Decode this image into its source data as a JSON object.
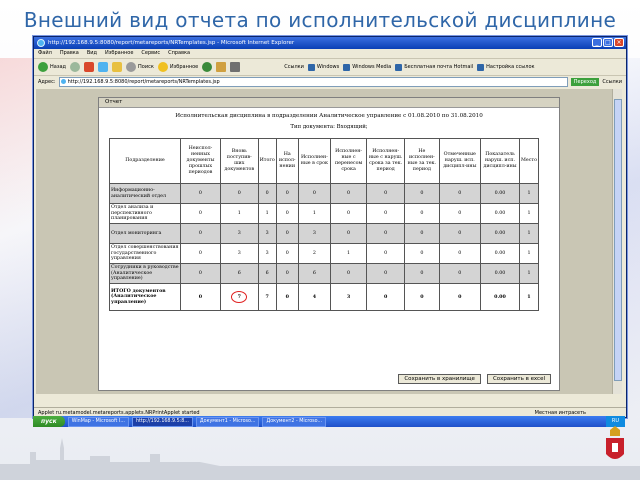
{
  "slide": {
    "title": "Внешний вид отчета по исполнительской дисциплине"
  },
  "window": {
    "title": "http://192.168.9.5:8080/report/metareports/NRTemplates.jsp - Microsoft Internet Explorer",
    "menu": [
      "Файл",
      "Правка",
      "Вид",
      "Избранное",
      "Сервис",
      "Справка"
    ],
    "toolbar": [
      "Назад",
      "Вперед",
      "Остановить",
      "Обновить",
      "Домой",
      "Поиск",
      "Избранное",
      "Журнал",
      "Почта",
      "Печать",
      "Ссылки",
      "Windows",
      "Windows Media",
      "Бесплатная почта Hotmail",
      "Настройка ссылок"
    ],
    "address_label": "Адрес:",
    "address": "http://192.168.9.5:8080/report/metareports/NRTemplates.jsp",
    "go_label": "Переход",
    "links_label": "Ссылки"
  },
  "report": {
    "caption": "Отчет",
    "title": "Исполнительская дисциплина в подразделении Аналитическое управление с 01.08.2010 по 31.08.2010",
    "doctype": "Тип документа: Входящий;",
    "columns": [
      "Подразделение",
      "Неиспол-ненных документы прошлых периодов",
      "Вновь поступив-ших документов",
      "Итого",
      "На испол-нении",
      "Исполнен-ные в срок",
      "Исполнен-ные с перенесом срока",
      "Исполнен-ные с наруш. срока за тек. период",
      "Не исполнен-ные за тек. период",
      "Отмеченные наруш. исп. дисципл-ины",
      "Показатель наруш. исп. дисципл-ины",
      "Место"
    ],
    "rows": [
      {
        "name": "Информационно-аналитический отдел",
        "vals": [
          "0",
          "0",
          "0",
          "0",
          "0",
          "0",
          "0",
          "0",
          "0",
          "0.00",
          "1"
        ]
      },
      {
        "name": "Отдел анализа и перспективного планирования",
        "vals": [
          "0",
          "1",
          "1",
          "0",
          "1",
          "0",
          "0",
          "0",
          "0",
          "0.00",
          "1"
        ]
      },
      {
        "name": "Отдел мониторинга",
        "vals": [
          "0",
          "3",
          "3",
          "0",
          "3",
          "0",
          "0",
          "0",
          "0",
          "0.00",
          "1"
        ]
      },
      {
        "name": "Отдел совершенствования государственного управления",
        "vals": [
          "0",
          "3",
          "3",
          "0",
          "2",
          "1",
          "0",
          "0",
          "0",
          "0.00",
          "1"
        ]
      },
      {
        "name": "Сотрудники в руководстве (Аналитическое управление)",
        "vals": [
          "0",
          "6",
          "6",
          "0",
          "6",
          "0",
          "0",
          "0",
          "0",
          "0.00",
          "1"
        ]
      },
      {
        "name": "ИТОГО документов (Аналитическое управление)",
        "vals": [
          "0",
          "7",
          "7",
          "0",
          "4",
          "3",
          "0",
          "0",
          "0",
          "0.00",
          "1"
        ]
      }
    ],
    "actions": [
      "Сохранить в хранилище",
      "Сохранить в excel"
    ]
  },
  "status": {
    "text": "Applet ru.metamodel.metareports.applets.NRPrintApplet started",
    "zone": "Местная интрасеть"
  },
  "taskbar": {
    "start": "пуск",
    "tasks": [
      "WinMap - Microsoft I...",
      "http://192.168.9.5:8...",
      "Документ1 - Microso...",
      "Документ2 - Microso..."
    ],
    "tray": "RU"
  },
  "colors": {
    "title": "#2f66a8",
    "xp_blue": "#0a3fb5",
    "highlight_circle": "#e02020"
  }
}
